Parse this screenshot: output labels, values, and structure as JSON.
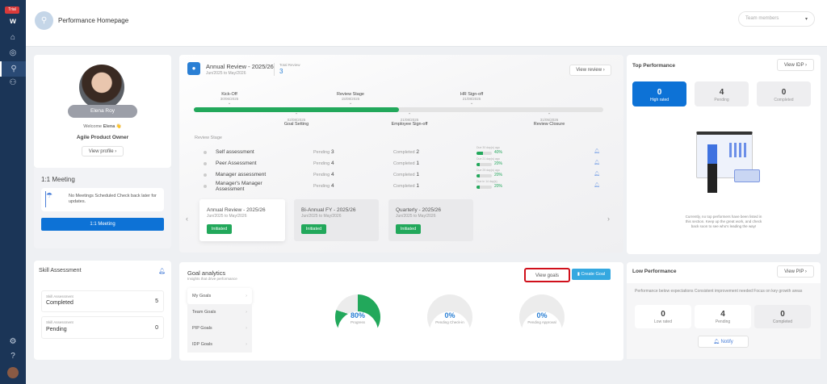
{
  "sidebar": {
    "trial": "Trial",
    "items": [
      "logo",
      "home-icon",
      "target-icon",
      "performance-icon",
      "team-icon"
    ],
    "bottom": [
      "settings-icon",
      "help-icon",
      "avatar"
    ]
  },
  "header": {
    "title": "Performance Homepage",
    "team_placeholder": "Team members"
  },
  "profile": {
    "name": "Elena Roy",
    "welcome": "Welcome",
    "first_name": "Elena",
    "role": "Agile Product Owner",
    "view_profile": "View profile"
  },
  "meeting": {
    "title": "1:1 Meeting",
    "empty": "No Meetings Scheduled Check back later for updates.",
    "button": "1:1 Meeting"
  },
  "skill": {
    "title": "Skill Assessment",
    "items": [
      {
        "label": "Skill Assessment",
        "status": "Completed",
        "value": "5"
      },
      {
        "label": "Skill Assessment",
        "status": "Pending",
        "value": "0"
      }
    ]
  },
  "review": {
    "title": "Annual Review - 2025/26",
    "period": "Jun/2025 to May/2026",
    "total_label": "Total Review",
    "total": "3",
    "view_button": "View review",
    "progress": 0.5,
    "top_milestones": [
      {
        "name": "Kick-Off",
        "date": "30/06/2025"
      },
      {
        "name": "Review Stage",
        "date": "15/08/2025"
      },
      {
        "name": "HR Sign-off",
        "date": "21/08/2025"
      }
    ],
    "bottom_milestones": [
      {
        "name": "Goal Setting",
        "date": "02/08/2025"
      },
      {
        "name": "Employee Sign-off",
        "date": "21/08/2025"
      },
      {
        "name": "Review Closure",
        "date": "31/05/2026"
      }
    ],
    "stage_label": "Review Stage",
    "stages": [
      {
        "name": "Self assessment",
        "pending_label": "Pending",
        "pending": "3",
        "completed_label": "Completed",
        "completed": "2",
        "due": "Due 30 day(s) ago",
        "percent": "40%",
        "fill": 40
      },
      {
        "name": "Peer Assessment",
        "pending_label": "Pending",
        "pending": "4",
        "completed_label": "Completed",
        "completed": "1",
        "due": "Due 21 day(s) ago",
        "percent": "20%",
        "fill": 20
      },
      {
        "name": "Manager assessment",
        "pending_label": "Pending",
        "pending": "4",
        "completed_label": "Completed",
        "completed": "1",
        "due": "Due 25 day(s) ago",
        "percent": "20%",
        "fill": 20
      },
      {
        "name": "Manager's Manager Assessment",
        "pending_label": "Pending",
        "pending": "4",
        "completed_label": "Completed",
        "completed": "1",
        "due": "Due in 14 day(s)",
        "percent": "20%",
        "fill": 20
      }
    ],
    "cycles": [
      {
        "title": "Annual Review - 2025/26",
        "period": "Jun/2025 to May/2026",
        "status": "Initiated"
      },
      {
        "title": "Bi-Annual FY - 2025/26",
        "period": "Jun/2025 to May/2026",
        "status": "Initiated"
      },
      {
        "title": "Quarterly - 2025/26",
        "period": "Jun/2025 to May/2026",
        "status": "Initiated"
      }
    ]
  },
  "goals": {
    "title": "Goal analytics",
    "subtitle": "Insights that drive performance",
    "view_goals": "View goals",
    "create_goal": "Create Goal",
    "nav": [
      "My Goals",
      "Team Goals",
      "PIP Goals",
      "IDP Goals"
    ],
    "rings": [
      {
        "value": "80%",
        "label": "Progress",
        "fill": 80
      },
      {
        "value": "0%",
        "label": "Pending Check-in",
        "fill": 0
      },
      {
        "value": "0%",
        "label": "Pending Approval",
        "fill": 0
      }
    ]
  },
  "top": {
    "title": "Top Performance",
    "button": "View IDP",
    "stats": [
      {
        "value": "0",
        "label": "High rated"
      },
      {
        "value": "4",
        "label": "Pending"
      },
      {
        "value": "0",
        "label": "Completed"
      }
    ],
    "empty": "Currently, no top performers have been listed in this section. Keep up the great work, and check back soon to see who's leading the way!"
  },
  "low": {
    "title": "Low Performance",
    "button": "View PIP",
    "desc": "Performance below expectations Consistent improvement needed Focus on key growth areas",
    "stats": [
      {
        "value": "0",
        "label": "Low rated"
      },
      {
        "value": "4",
        "label": "Pending"
      },
      {
        "value": "0",
        "label": "Completed"
      }
    ],
    "notify": "Notify"
  },
  "colors": {
    "sidebar": "#1b3557",
    "primary": "#0d72d6",
    "success": "#22a85b",
    "highlight": "#d0101b"
  }
}
